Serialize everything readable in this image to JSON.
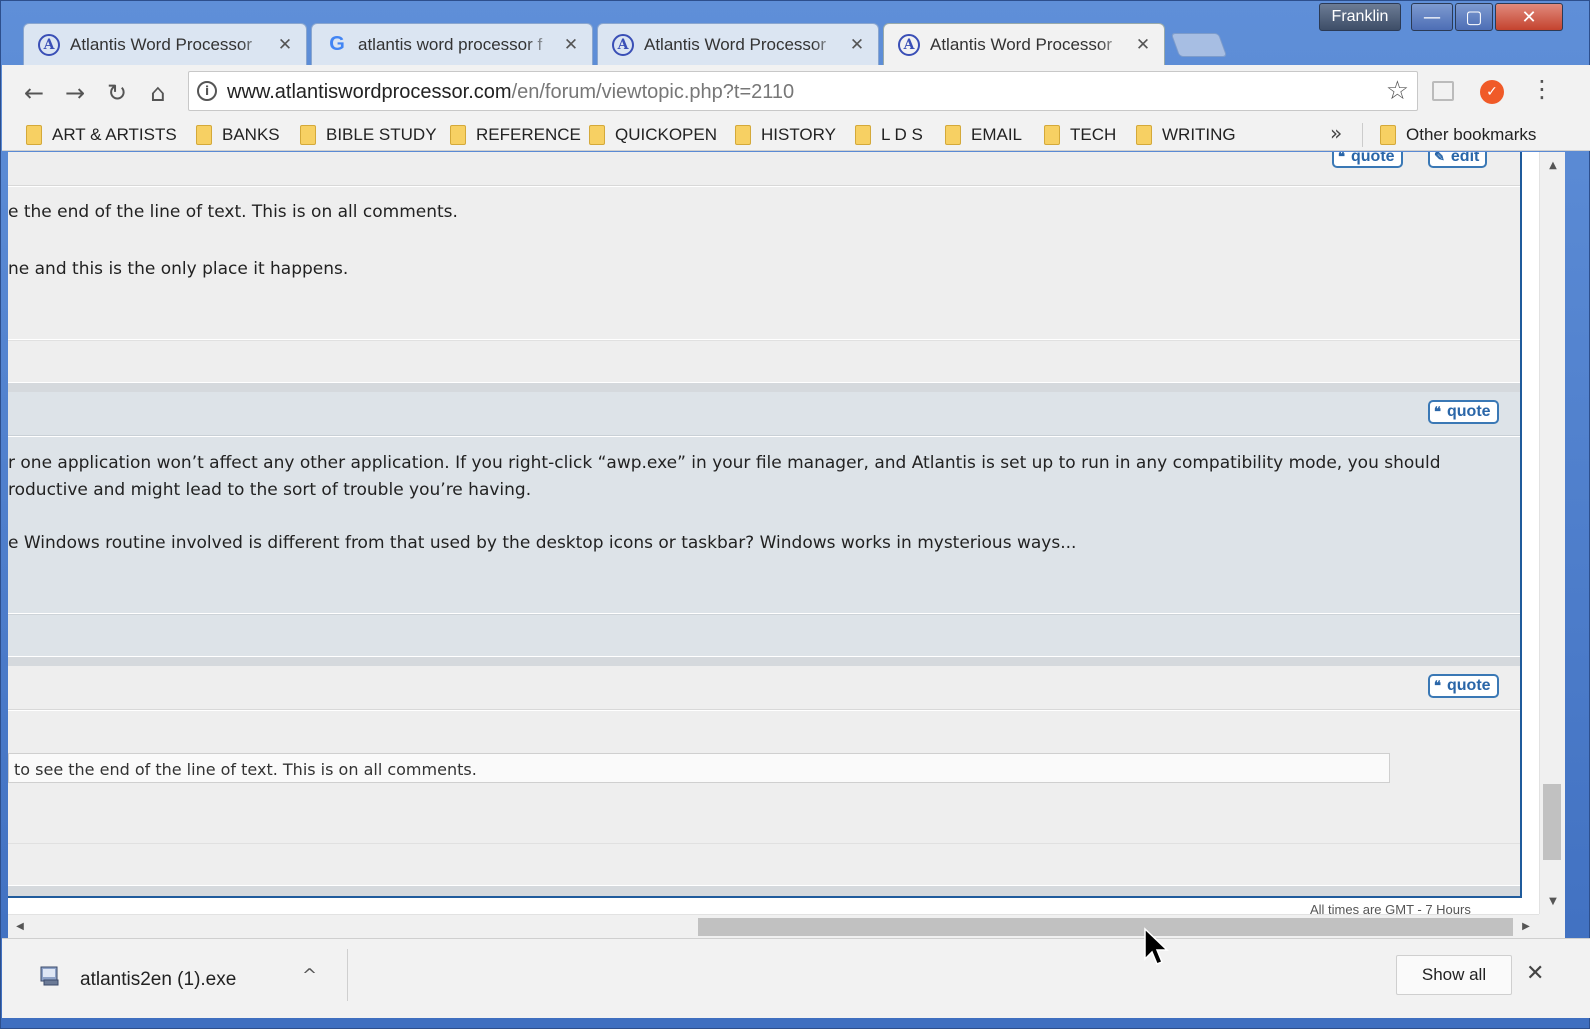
{
  "window": {
    "profile": "Franklin",
    "minimize": "—",
    "maximize": "▢",
    "close": "✕"
  },
  "tabs": [
    {
      "title": "Atlantis Word Processor",
      "favicon": "A",
      "close": "✕"
    },
    {
      "title": "atlantis word processor f",
      "favicon": "G",
      "close": "✕"
    },
    {
      "title": "Atlantis Word Processor",
      "favicon": "A",
      "close": "✕"
    },
    {
      "title": "Atlantis Word Processor",
      "favicon": "A",
      "close": "✕"
    }
  ],
  "toolbar": {
    "back": "←",
    "forward": "→",
    "reload": "↻",
    "home": "⌂",
    "url_domain": "www.atlantiswordprocessor.com",
    "url_path": "/en/forum/viewtopic.php?t=2110",
    "info": "i",
    "star": "☆",
    "menu": "⋮"
  },
  "bookmarks": [
    "ART & ARTISTS",
    "BANKS",
    "BIBLE STUDY",
    "REFERENCE",
    "QUICKOPEN",
    "HISTORY",
    "L D S",
    "EMAIL",
    "TECH",
    "WRITING"
  ],
  "bookmarks_more": "»",
  "other_bookmarks": "Other bookmarks",
  "page": {
    "top_buttons": {
      "quote": "quote",
      "edit": "edit"
    },
    "post1": [
      "e the end of the line of text. This is on all comments.",
      "ne and this is the only place it happens."
    ],
    "post2_quote": "quote",
    "post2": [
      "r one application won’t affect any other application. If you right-click “awp.exe” in your file manager, and Atlantis is set up to run in any compatibility mode, you should",
      "roductive and might lead to the sort of trouble you’re having.",
      "e Windows routine involved is different from that used by the desktop icons or taskbar? Windows works in mysterious ways..."
    ],
    "post3_quote": "quote",
    "post3_quote_text": " to see the end of the line of text. This is on all comments.",
    "footer": "All times are GMT - 7 Hours"
  },
  "downloads": {
    "file": "atlantis2en (1).exe",
    "chevron": "^",
    "show_all": "Show all",
    "close": "✕"
  }
}
